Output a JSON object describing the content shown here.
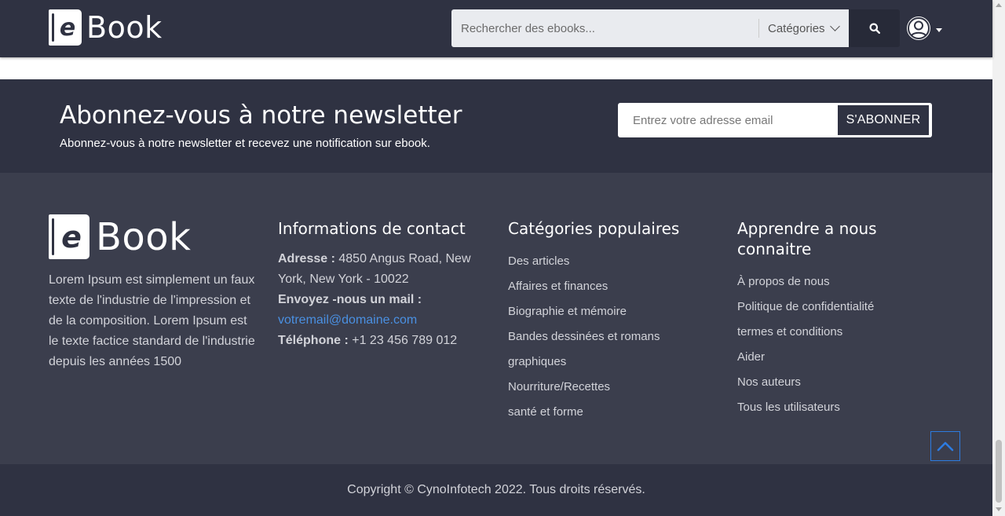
{
  "header": {
    "logo": {
      "letter": "e",
      "word": "Book"
    },
    "search": {
      "placeholder": "Rechercher des ebooks...",
      "categories_label": "Catégories"
    },
    "icons": {
      "search": "search-icon",
      "user": "user-avatar-icon",
      "caret": "caret-down-icon"
    }
  },
  "newsletter": {
    "title": "Abonnez-vous à notre newsletter",
    "subtitle": "Abonnez-vous à notre newsletter et recevez une notification sur ebook.",
    "email_placeholder": "Entrez votre adresse email",
    "button_label": "S'ABONNER"
  },
  "footer": {
    "about": {
      "logo": {
        "letter": "e",
        "word": "Book"
      },
      "text": "Lorem Ipsum est simplement un faux texte de l'industrie de l'impression et de la composition. Lorem Ipsum est le texte factice standard de l'industrie depuis les années 1500"
    },
    "contact": {
      "title": "Informations de contact",
      "address_label": "Adresse :",
      "address_value": "4850 Angus Road, New York, New York - 10022",
      "email_label": "Envoyez -nous un mail :",
      "email_value": "votremail@domaine.com",
      "phone_label": "Téléphone :",
      "phone_value": "+1 23 456 789 012"
    },
    "categories": {
      "title": "Catégories populaires",
      "items": [
        "Des articles",
        "Affaires et finances",
        "Biographie et mémoire",
        "Bandes dessinées et romans",
        "graphiques",
        "Nourriture/Recettes",
        "santé et forme"
      ]
    },
    "learn": {
      "title": "Apprendre a nous connaitre",
      "items": [
        "À propos de nous",
        "Politique de confidentialité",
        "termes et conditions",
        "Aider",
        "Nos auteurs",
        "Tous les utilisateurs"
      ]
    },
    "copyright": "Copyright © CynoInfotech 2022. Tous droits réservés."
  },
  "colors": {
    "header_bg": "#2f3242",
    "footer_bg": "#3b3e4d",
    "accent_link": "#4a90e2",
    "to_top_border": "#2d7be0"
  }
}
